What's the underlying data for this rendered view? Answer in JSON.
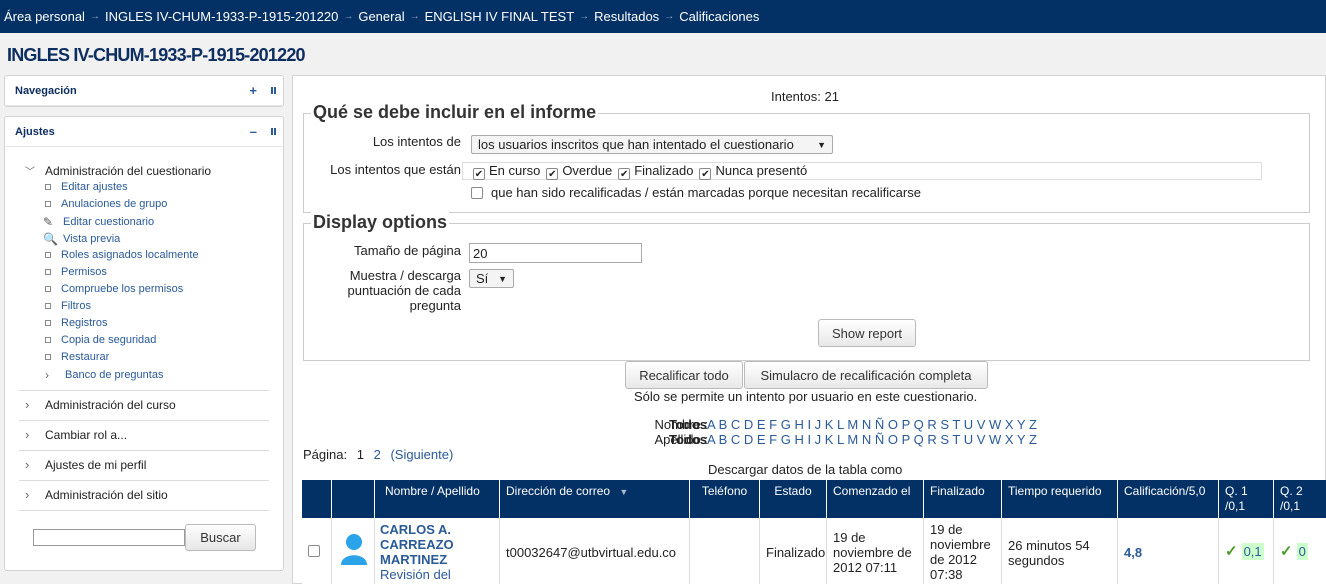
{
  "breadcrumb": [
    "Área personal",
    "INGLES IV-CHUM-1933-P-1915-201220",
    "General",
    "ENGLISH IV FINAL TEST",
    "Resultados",
    "Calificaciones"
  ],
  "breadcrumb_separator": "→",
  "course_title": "INGLES IV-CHUM-1933-P-1915-201220",
  "nav_block": {
    "title": "Navegación",
    "ctl": "+"
  },
  "settings_block": {
    "title": "Ajustes",
    "ctl": "–",
    "quiz_admin": "Administración del cuestionario",
    "quiz_items": [
      "Editar ajustes",
      "Anulaciones de grupo",
      "Editar cuestionario",
      "Vista previa",
      "Roles asignados localmente",
      "Permisos",
      "Compruebe los permisos",
      "Filtros",
      "Registros",
      "Copia de seguridad",
      "Restaurar",
      "Banco de preguntas"
    ],
    "quiz_item_icons": [
      "bullet-icon",
      "bullet-icon",
      "pencil-icon",
      "magnifier-icon",
      "bullet-icon",
      "bullet-icon",
      "bullet-icon",
      "bullet-icon",
      "bullet-icon",
      "bullet-icon",
      "bullet-icon",
      "chevron-right-icon"
    ],
    "sections": [
      "Administración del curso",
      "Cambiar rol a...",
      "Ajustes de mi perfil",
      "Administración del sitio"
    ],
    "search_button": "Buscar"
  },
  "main": {
    "attempts_count": "Intentos: 21",
    "include_legend": "Qué se debe incluir en el informe",
    "attempts_from_label": "Los intentos de",
    "attempts_from_value": "los usuarios inscritos que han intentado el cuestionario",
    "attempts_state_label": "Los intentos que están",
    "states": [
      "En curso",
      "Overdue",
      "Finalizado",
      "Nunca presentó"
    ],
    "regrade_label": "que han sido recalificadas / están marcadas porque necesitan recalificarse",
    "display_legend": "Display options",
    "page_size_label": "Tamaño de página",
    "page_size_value": "20",
    "show_marks_label": "Muestra / descarga puntuación de cada pregunta",
    "show_marks_value": "Sí",
    "show_report_button": "Show report",
    "regrade_all_button": "Recalificar todo",
    "dry_run_button": "Simulacro de recalificación completa",
    "one_attempt_note": "Sólo se permite un intento por usuario en este cuestionario.",
    "first_name_label": "Nombre :",
    "last_name_label": "Apellido :",
    "all_label": "Todos",
    "letters": "A B C D E F G H I J K L M N Ñ O P Q R S T U V W X Y Z",
    "page_label": "Página:",
    "page_current": "1",
    "page_2": "2",
    "page_next": "(Siguiente)",
    "download_label": "Descargar datos de la tabla como"
  },
  "table": {
    "headers": {
      "name": "Nombre",
      "name_sep": "/",
      "surname": "Apellido",
      "email": "Dirección de correo",
      "phone": "Teléfono",
      "state": "Estado",
      "started": "Comenzado el",
      "finished": "Finalizado",
      "duration": "Tiempo requerido",
      "grade": "Calificación/5,0",
      "q1": "Q. 1 /0,1",
      "q2": "Q. 2 /0,1"
    },
    "row": {
      "name": "CARLOS A. CARREAZO MARTINEZ",
      "review": "Revisión del intento",
      "email": "t00032647@utbvirtual.edu.co",
      "phone": "",
      "state": "Finalizado",
      "started": "19 de noviembre de 2012 07:11",
      "finished": "19 de noviembre de 2012 07:38",
      "duration": "26 minutos 54 segundos",
      "grade": "4,8",
      "q1": "0,1",
      "q2": "0"
    }
  },
  "colors": {
    "navbar": "#033166",
    "link": "#2a5a98",
    "correct": "#4a9a2a"
  }
}
